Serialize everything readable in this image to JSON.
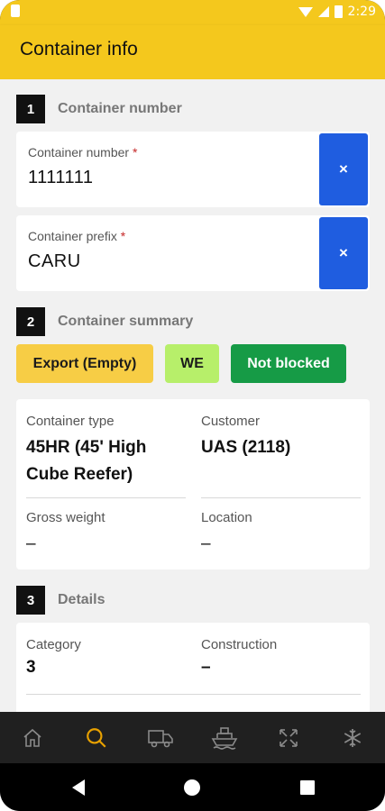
{
  "status_bar": {
    "time": "2:29"
  },
  "app_bar": {
    "title": "Container info"
  },
  "sections": [
    {
      "number": "1",
      "title": "Container number"
    },
    {
      "number": "2",
      "title": "Container summary"
    },
    {
      "number": "3",
      "title": "Details"
    }
  ],
  "fields": {
    "container_number": {
      "label": "Container number",
      "required_mark": "*",
      "value": "1111111",
      "clear_label": "×"
    },
    "container_prefix": {
      "label": "Container prefix",
      "required_mark": "*",
      "value": "CARU",
      "clear_label": "×"
    }
  },
  "chips": {
    "status": "Export (Empty)",
    "code": "WE",
    "blocked": "Not blocked"
  },
  "summary": {
    "container_type": {
      "label": "Container type",
      "value": "45HR (45' High Cube Reefer)"
    },
    "customer": {
      "label": "Customer",
      "value": "UAS (2118)"
    },
    "gross_weight": {
      "label": "Gross weight",
      "value": "–"
    },
    "location": {
      "label": "Location",
      "value": "–"
    }
  },
  "details": {
    "category": {
      "label": "Category",
      "value": "3"
    },
    "construction": {
      "label": "Construction",
      "value": "–"
    }
  },
  "bottom_nav": [
    {
      "name": "home-icon",
      "active": false
    },
    {
      "name": "search-icon",
      "active": true
    },
    {
      "name": "truck-icon",
      "active": false
    },
    {
      "name": "ship-icon",
      "active": false
    },
    {
      "name": "expand-icon",
      "active": false
    },
    {
      "name": "snowflake-icon",
      "active": false
    }
  ],
  "colors": {
    "brand_yellow": "#f4c81d",
    "clear_button_blue": "#1f5de0",
    "chip_export": "#f7cd45",
    "chip_we": "#b7ef6a",
    "chip_not_blocked": "#169b46",
    "nav_active": "#e8a100",
    "nav_inactive": "#8a8a8a"
  }
}
